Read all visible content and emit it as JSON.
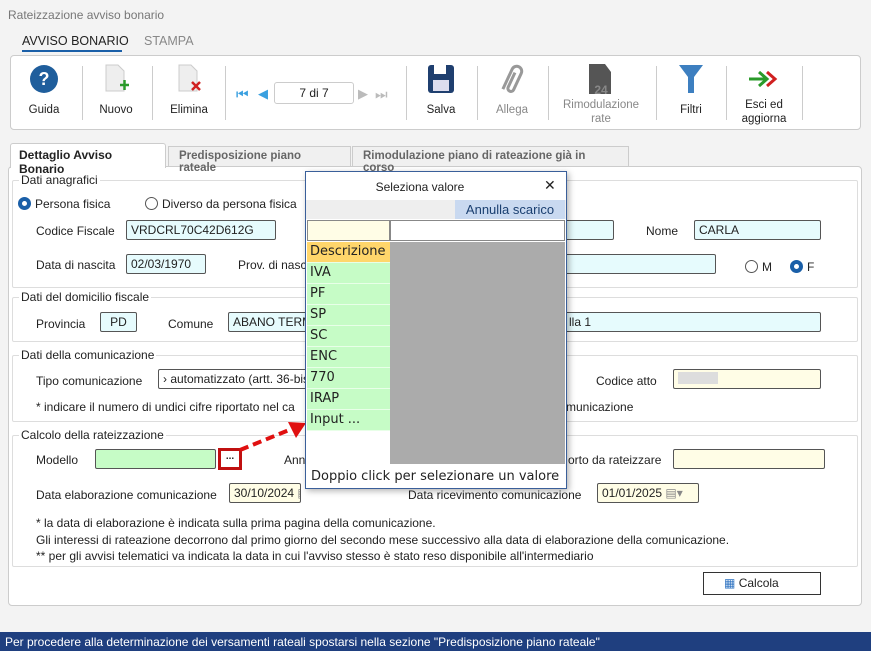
{
  "window": {
    "title": "Rateizzazione avviso bonario"
  },
  "ribbon_tabs": [
    {
      "label": "AVVISO BONARIO",
      "active": true
    },
    {
      "label": "STAMPA",
      "active": false
    }
  ],
  "toolbar": {
    "guida": "Guida",
    "nuovo": "Nuovo",
    "elimina": "Elimina",
    "record": "7 di 7",
    "salva": "Salva",
    "allega": "Allega",
    "rimodulazione": "Rimodulazione rate",
    "filtri": "Filtri",
    "esci": "Esci ed aggiorna"
  },
  "tabs": [
    {
      "label": "Dettaglio Avviso Bonario",
      "active": true
    },
    {
      "label": "Predisposizione piano rateale"
    },
    {
      "label": "Rimodulazione piano di rateazione già in corso"
    }
  ],
  "anagrafici": {
    "title": "Dati anagrafici",
    "persona_fisica": "Persona fisica",
    "diverso": "Diverso da persona fisica",
    "cf_label": "Codice Fiscale",
    "cf": "VRDCRL70C42D612G",
    "nome_label": "Nome",
    "nome": "CARLA",
    "nascita_label": "Data di nascita",
    "nascita": "02/03/1970",
    "prov_label": "Prov. di nasc",
    "m": "M",
    "f": "F",
    "sex_selected": "F"
  },
  "domicilio": {
    "title": "Dati del domicilio fiscale",
    "prov_label": "Provincia",
    "prov": "PD",
    "comune_label": "Comune",
    "comune": "ABANO TERM",
    "indirizzo_tail": "lla 1"
  },
  "comunicazione": {
    "title": "Dati della comunicazione",
    "tipo_label": "Tipo comunicazione",
    "tipo": "› automatizzato (artt. 36-bis",
    "codice_label": "Codice atto",
    "note_a": "* indicare il numero di undici cifre riportato nel ca",
    "note_b": "municazione"
  },
  "calcolo": {
    "title": "Calcolo della rateizzazione",
    "modello_label": "Modello",
    "modello": "",
    "browse": "...",
    "anno_label": "Ann",
    "importo_label": "orto da rateizzare",
    "elab_label": "Data elaborazione comunicazione",
    "elab": "30/10/2024",
    "ricev_label": "Data ricevimento comunicazione",
    "ricev": "01/01/2025",
    "note1": "* la data di elaborazione è indicata sulla prima pagina della comunicazione.",
    "note2": "Gli interessi di rateazione decorrono dal primo giorno del secondo mese successivo alla data di elaborazione della comunicazione.",
    "note3": "** per gli avvisi telematici va indicata la data in cui l'avviso stesso è stato reso disponibile all'intermediario",
    "calcola": "Calcola"
  },
  "popup": {
    "title": "Seleziona valore",
    "close": "✕",
    "annulla": "Annulla scarico",
    "filter": "",
    "header": "Descrizione",
    "items": [
      "IVA",
      "PF",
      "SP",
      "SC",
      "ENC",
      "770",
      "IRAP",
      "Input ..."
    ],
    "footer": "Doppio click per selezionare un valore"
  },
  "status": "Per procedere alla determinazione dei versamenti rateali spostarsi nella sezione \"Predisposizione piano rateale\"",
  "colors": {
    "accent": "#1a5fa8",
    "status_bar": "#1f3f7f",
    "highlight": "#d0021b"
  }
}
